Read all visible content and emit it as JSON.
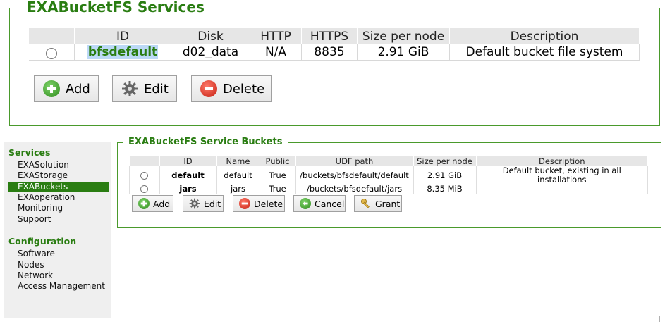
{
  "services": {
    "legend": "EXABucketFS Services",
    "columns": [
      "ID",
      "Disk",
      "HTTP",
      "HTTPS",
      "Size per node",
      "Description"
    ],
    "rows": [
      {
        "id": "bfsdefault",
        "disk": "d02_data",
        "http": "N/A",
        "https": "8835",
        "size": "2.91 GiB",
        "description": "Default bucket file system"
      }
    ],
    "buttons": {
      "add": "Add",
      "edit": "Edit",
      "delete": "Delete"
    }
  },
  "buckets": {
    "legend": "EXABucketFS Service Buckets",
    "columns": [
      "ID",
      "Name",
      "Public",
      "UDF path",
      "Size per node",
      "Description"
    ],
    "rows": [
      {
        "id": "default",
        "name": "default",
        "public": "True",
        "udf_path": "/buckets/bfsdefault/default",
        "size": "2.91 GiB",
        "description": "Default bucket, existing in all installations"
      },
      {
        "id": "jars",
        "name": "jars",
        "public": "True",
        "udf_path": "/buckets/bfsdefault/jars",
        "size": "8.35 MiB",
        "description": ""
      }
    ],
    "buttons": {
      "add": "Add",
      "edit": "Edit",
      "delete": "Delete",
      "cancel": "Cancel",
      "grant": "Grant"
    }
  },
  "sidebar": {
    "services_heading": "Services",
    "services_items": [
      "EXASolution",
      "EXAStorage",
      "EXABuckets",
      "EXAoperation",
      "Monitoring",
      "Support"
    ],
    "active_item": "EXABuckets",
    "configuration_heading": "Configuration",
    "configuration_items": [
      "Software",
      "Nodes",
      "Network",
      "Access Management"
    ]
  },
  "colors": {
    "accent": "#2a7d12",
    "border": "#4a9a2c",
    "selection": "#bcd9f6"
  },
  "cursor_icon": "text-cursor-icon"
}
